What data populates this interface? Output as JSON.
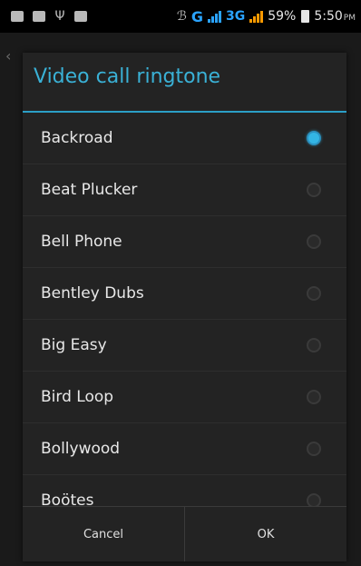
{
  "status_bar": {
    "network_label": "G",
    "network2_label": "3G",
    "battery": "59%",
    "time": "5:50",
    "ampm": "PM",
    "colors": {
      "network_blue": "#2aa3ff",
      "network_orange": "#ff9a00"
    }
  },
  "dialog": {
    "title": "Video call ringtone",
    "items": [
      {
        "label": "Backroad",
        "selected": true
      },
      {
        "label": "Beat Plucker",
        "selected": false
      },
      {
        "label": "Bell Phone",
        "selected": false
      },
      {
        "label": "Bentley Dubs",
        "selected": false
      },
      {
        "label": "Big Easy",
        "selected": false
      },
      {
        "label": "Bird Loop",
        "selected": false
      },
      {
        "label": "Bollywood",
        "selected": false
      },
      {
        "label": "Boötes",
        "selected": false
      }
    ],
    "cancel_label": "Cancel",
    "ok_label": "OK",
    "accent_color": "#33b5e5"
  }
}
